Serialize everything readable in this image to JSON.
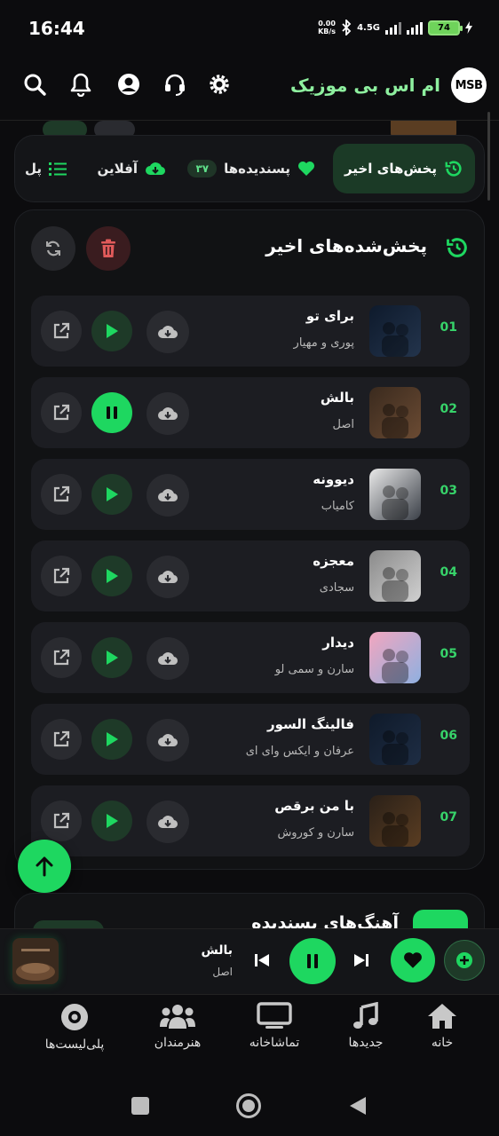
{
  "status": {
    "time": "16:44",
    "net_speed_top": "0.00",
    "net_speed_bottom": "KB/s",
    "network": "4.5G",
    "battery": "74"
  },
  "header": {
    "app_title": "ام اس بی موزیک",
    "logo_text": "MSB"
  },
  "tabs": {
    "recent": "پخش‌های اخیر",
    "favorites": "پسندیده‌ها",
    "favorites_count": "۳۷",
    "offline": "آفلاین",
    "playlists_partial": "پل"
  },
  "recent_panel": {
    "title": "پخش‌شده‌های اخیر",
    "tracks": [
      {
        "num": "01",
        "title": "برای تو",
        "artist": "پوری و مهیار",
        "playing": false,
        "cover": [
          "#0e1a2c",
          "#23344c"
        ]
      },
      {
        "num": "02",
        "title": "بالش",
        "artist": "اصل",
        "playing": true,
        "cover": [
          "#3a2a1e",
          "#6b4b33"
        ]
      },
      {
        "num": "03",
        "title": "دیوونه",
        "artist": "کامیاب",
        "playing": false,
        "cover": [
          "#e9e9e9",
          "#3b4048"
        ]
      },
      {
        "num": "04",
        "title": "معجزه",
        "artist": "سجادی",
        "playing": false,
        "cover": [
          "#8a8a8a",
          "#d0d0d0"
        ]
      },
      {
        "num": "05",
        "title": "دیدار",
        "artist": "سارن و سمی لو",
        "playing": false,
        "cover": [
          "#f2a6bf",
          "#8fb0e0"
        ]
      },
      {
        "num": "06",
        "title": "فالینگ السور",
        "artist": "عرفان و ایکس وای ای",
        "playing": false,
        "cover": [
          "#0f1a2a",
          "#1e2d44"
        ]
      },
      {
        "num": "07",
        "title": "با من برقص",
        "artist": "سارن و کوروش",
        "playing": false,
        "cover": [
          "#2a2018",
          "#5a3d22"
        ]
      }
    ]
  },
  "favorites_section": {
    "title": "آهنگ‌های پسندیده"
  },
  "mini_player": {
    "title": "بالش",
    "artist": "اصل"
  },
  "bottom_nav": [
    {
      "label": "خانه",
      "icon": "home-icon"
    },
    {
      "label": "جدیدها",
      "icon": "music-note-icon"
    },
    {
      "label": "تماشاخانه",
      "icon": "tv-icon"
    },
    {
      "label": "هنرمندان",
      "icon": "users-icon"
    },
    {
      "label": "پلی‌لیست‌ها",
      "icon": "disc-icon"
    }
  ],
  "colors": {
    "accent": "#1ed760",
    "accent_dark": "#1e3a28",
    "danger": "#e05a5a",
    "title_green": "#8ef09f"
  }
}
